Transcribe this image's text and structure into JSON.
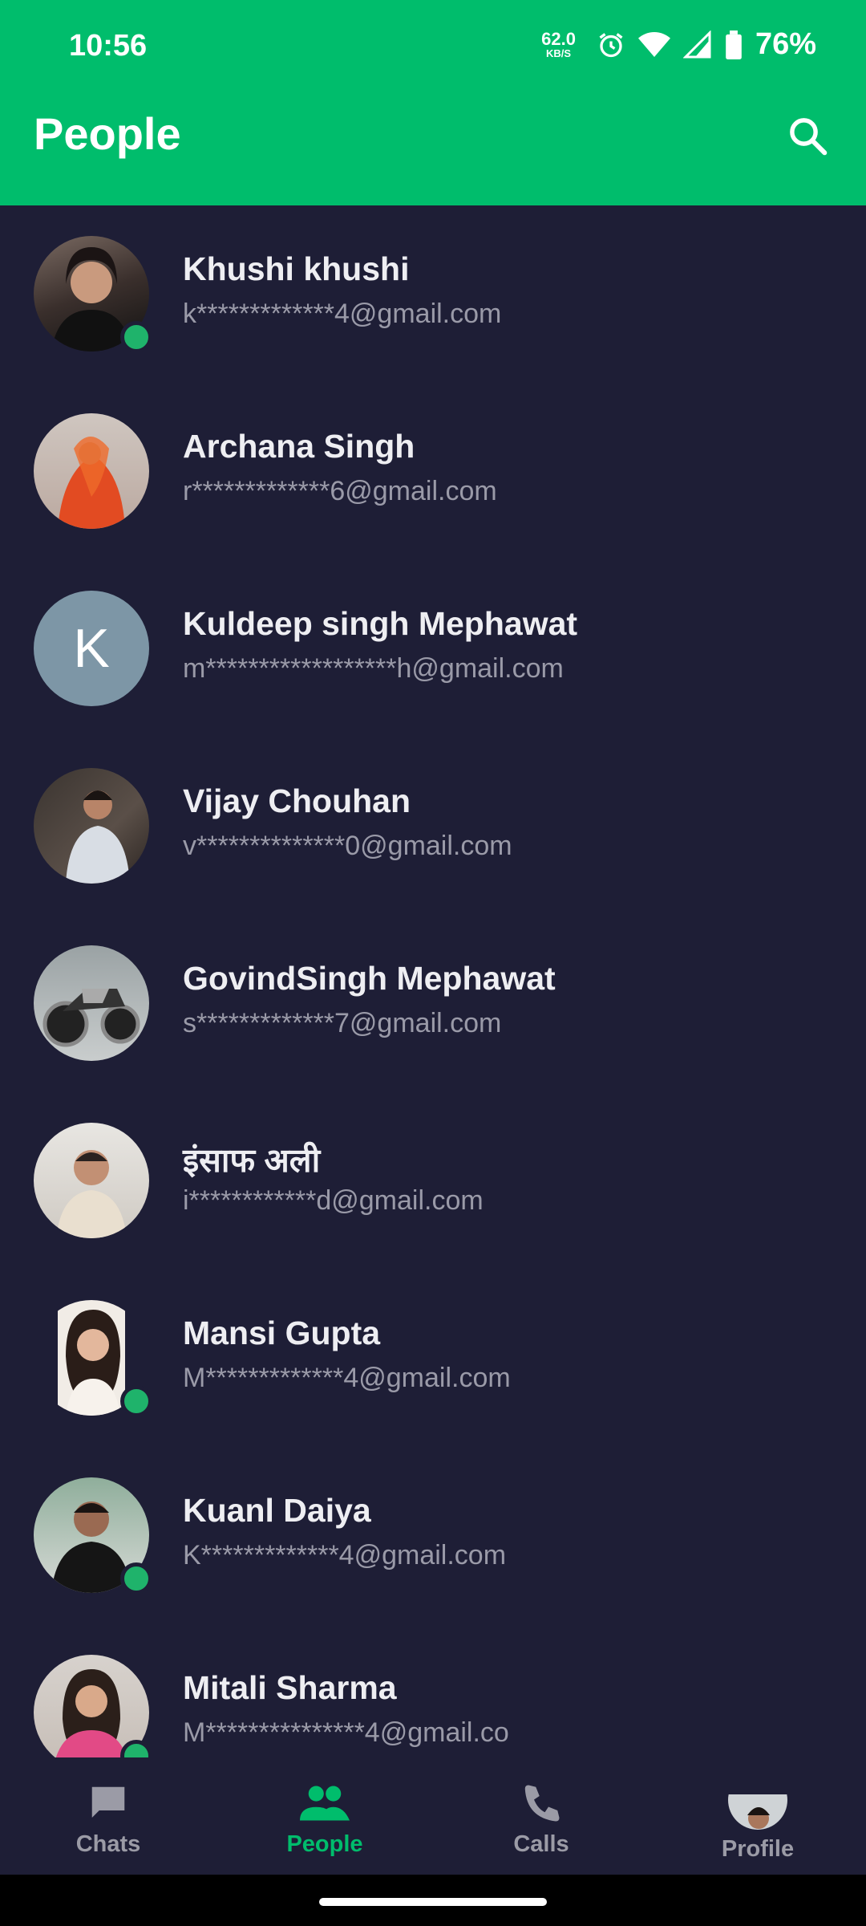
{
  "status_bar": {
    "time": "10:56",
    "net_speed_value": "62.0",
    "net_speed_unit": "KB/S",
    "battery": "76%",
    "icons": [
      "alarm-icon",
      "wifi-icon",
      "signal-icon",
      "battery-icon"
    ]
  },
  "header": {
    "title": "People",
    "search_icon": "search-icon",
    "background": "#00bd6c"
  },
  "people": [
    {
      "name": "Khushi khushi",
      "email": "k*************4@gmail.com",
      "online": true,
      "avatar": "photo"
    },
    {
      "name": "Archana Singh",
      "email": "r*************6@gmail.com",
      "online": false,
      "avatar": "photo"
    },
    {
      "name": "Kuldeep singh Mephawat",
      "email": "m******************h@gmail.com",
      "online": false,
      "avatar": "letter",
      "initial": "K"
    },
    {
      "name": "Vijay Chouhan",
      "email": "v**************0@gmail.com",
      "online": false,
      "avatar": "photo"
    },
    {
      "name": "GovindSingh Mephawat",
      "email": "s*************7@gmail.com",
      "online": false,
      "avatar": "photo"
    },
    {
      "name": "इंसाफ अली",
      "email": "i************d@gmail.com",
      "online": false,
      "avatar": "photo"
    },
    {
      "name": "Mansi Gupta",
      "email": "M*************4@gmail.com",
      "online": true,
      "avatar": "photo"
    },
    {
      "name": "Kuanl Daiya",
      "email": "K*************4@gmail.com",
      "online": true,
      "avatar": "photo"
    },
    {
      "name": "Mitali Sharma",
      "email": "M***************4@gmail.co",
      "online": true,
      "avatar": "photo"
    }
  ],
  "bottom_nav": {
    "items": [
      {
        "label": "Chats",
        "icon": "chat-icon",
        "active": false
      },
      {
        "label": "People",
        "icon": "people-icon",
        "active": true
      },
      {
        "label": "Calls",
        "icon": "phone-icon",
        "active": false
      },
      {
        "label": "Profile",
        "icon": "profile-avatar",
        "active": false
      }
    ]
  },
  "colors": {
    "accent": "#00bd6c",
    "background": "#1e1e36",
    "online": "#1fb36b"
  }
}
